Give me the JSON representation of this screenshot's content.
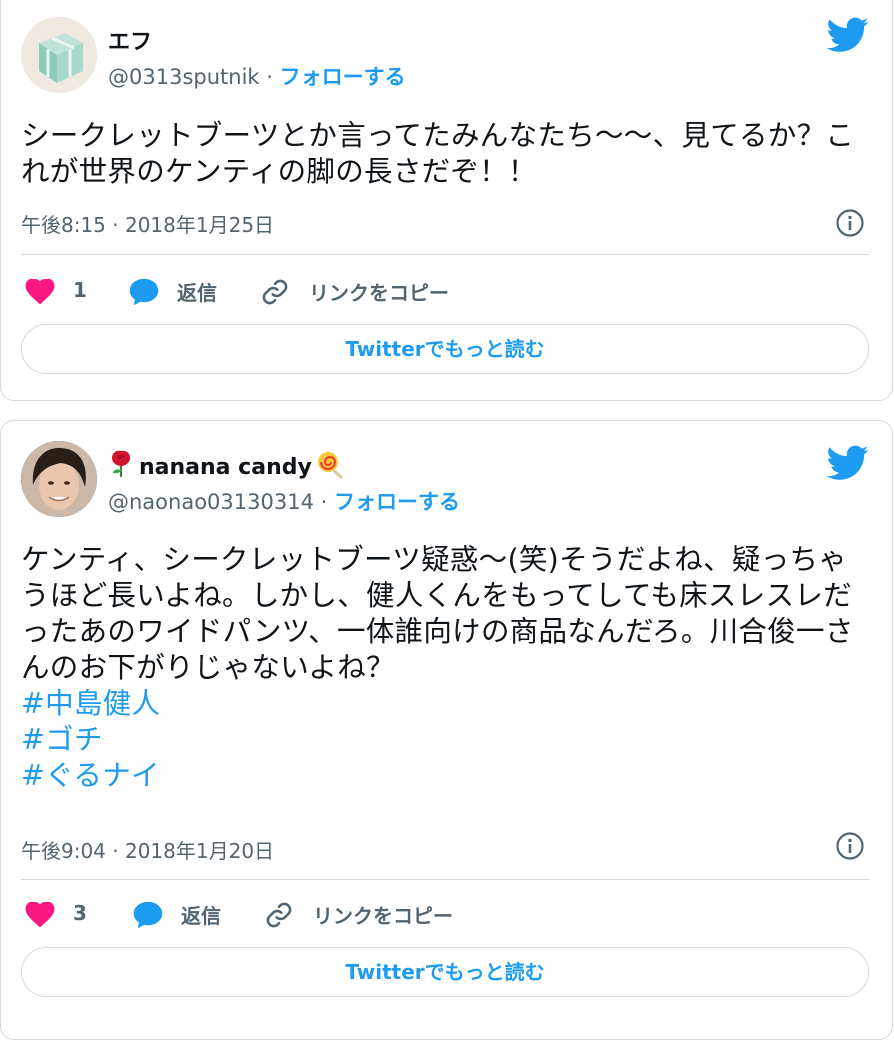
{
  "tweets": [
    {
      "display_name": "エフ",
      "handle": "@0313sputnik",
      "separator": "·",
      "follow_label": "フォローする",
      "text": "シークレットブーツとか言ってたみんなたち〜〜、見てるか？これが世界のケンティの脚の長さだぞ！！",
      "hashtags": [],
      "timestamp": "午後8:15 · 2018年1月25日",
      "like_count": "1",
      "reply_label": "返信",
      "copy_link_label": "リンクをコピー",
      "read_more_label": "Twitterでもっと読む"
    },
    {
      "display_name": "nanana candy",
      "handle": "@naonao03130314",
      "separator": "·",
      "follow_label": "フォローする",
      "text": "ケンティ、シークレットブーツ疑惑〜(笑)そうだよね、疑っちゃうほど長いよね。しかし、健人くんをもってしても床スレスレだったあのワイドパンツ、一体誰向けの商品なんだろ。川合俊一さんのお下がりじゃないよね？",
      "hashtags": [
        "#中島健人",
        "#ゴチ",
        "#ぐるナイ"
      ],
      "timestamp": "午後9:04 · 2018年1月20日",
      "like_count": "3",
      "reply_label": "返信",
      "copy_link_label": "リンクをコピー",
      "read_more_label": "Twitterでもっと読む"
    }
  ],
  "icons": [
    "twitter-bird-icon",
    "info-icon",
    "heart-icon",
    "reply-bubble-icon",
    "link-icon",
    "rose-emoji",
    "lollipop-emoji"
  ],
  "colors": {
    "accent": "#1d9bf0",
    "like": "#f91880",
    "muted": "#536471",
    "border": "#cfd9de"
  }
}
